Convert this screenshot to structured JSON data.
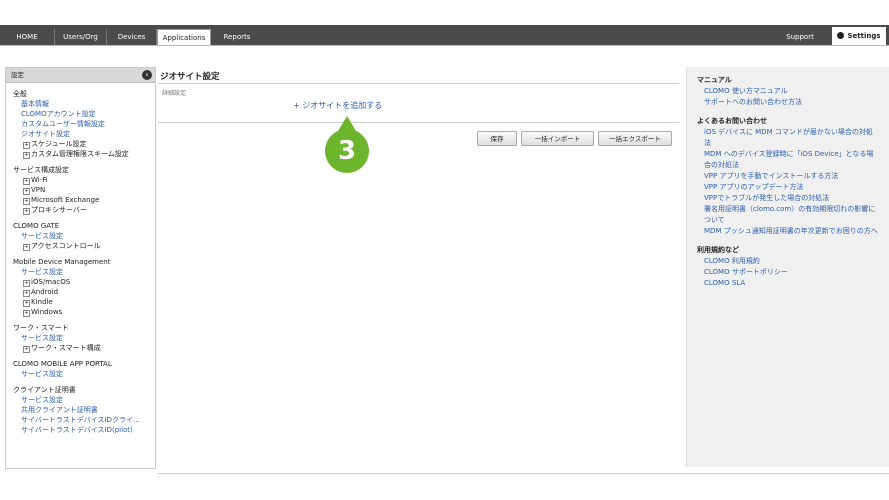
{
  "nav": {
    "tabs": [
      "HOME",
      "Users/Org",
      "Devices",
      "Applications",
      "Reports"
    ],
    "support": "Support",
    "settings": "Settings"
  },
  "sidebar": {
    "header": "設定",
    "groups": [
      {
        "title": "全般",
        "items": [
          {
            "type": "link",
            "label": "基本情報"
          },
          {
            "type": "link",
            "label": "CLOMOアカウント設定"
          },
          {
            "type": "link",
            "label": "カスタムユーザー情報設定"
          },
          {
            "type": "link",
            "label": "ジオサイト設定"
          },
          {
            "type": "sub",
            "label": "スケジュール設定"
          },
          {
            "type": "sub",
            "label": "カスタム管理権限スキーム設定"
          }
        ]
      },
      {
        "title": "サービス構成設定",
        "items": [
          {
            "type": "sub",
            "label": "Wi-Fi"
          },
          {
            "type": "sub",
            "label": "VPN"
          },
          {
            "type": "sub",
            "label": "Microsoft Exchange"
          },
          {
            "type": "sub",
            "label": "プロキシサーバー"
          }
        ]
      },
      {
        "title": "CLOMO GATE",
        "items": [
          {
            "type": "link",
            "label": "サービス設定"
          },
          {
            "type": "sub",
            "label": "アクセスコントロール"
          }
        ]
      },
      {
        "title": "Mobile Device Management",
        "items": [
          {
            "type": "link",
            "label": "サービス設定"
          },
          {
            "type": "sub",
            "label": "iOS/macOS"
          },
          {
            "type": "sub",
            "label": "Android"
          },
          {
            "type": "sub",
            "label": "Kindle"
          },
          {
            "type": "sub",
            "label": "Windows"
          }
        ]
      },
      {
        "title": "ワーク・スマート",
        "items": [
          {
            "type": "link",
            "label": "サービス設定"
          },
          {
            "type": "sub",
            "label": "ワーク・スマート構成"
          }
        ]
      },
      {
        "title": "CLOMO MOBILE APP PORTAL",
        "items": [
          {
            "type": "link",
            "label": "サービス設定"
          }
        ]
      },
      {
        "title": "クライアント証明書",
        "items": [
          {
            "type": "link",
            "label": "サービス設定"
          },
          {
            "type": "link",
            "label": "共用クライアント証明書"
          },
          {
            "type": "link",
            "label": "サイバートラストデバイスIDクライ..."
          },
          {
            "type": "link",
            "label": "サイバートラストデバイスID(pilot)"
          }
        ]
      }
    ]
  },
  "main": {
    "title": "ジオサイト設定",
    "detail_label": "詳細設定",
    "add_link": "+ ジオサイトを追加する",
    "buttons": {
      "save": "保存",
      "import": "一括インポート",
      "export": "一括エクスポート"
    },
    "callout": "3"
  },
  "help": {
    "manual_title": "マニュアル",
    "manual_links": [
      "CLOMO 使い方マニュアル",
      "サポートへのお問い合わせ方法"
    ],
    "faq_title": "よくあるお問い合わせ",
    "faq_links": [
      "iOS デバイスに MDM コマンドが届かない場合の対処法",
      "MDM へのデバイス登録時に「iOS Device」となる場合の対処法",
      "VPP アプリを手動でインストールする方法",
      "VPP アプリのアップデート方法",
      "VPPでトラブルが発生した場合の対処法",
      "署名用証明書（clomo.com）の有効期限切れの影響について",
      "MDM プッシュ通知用証明書の年次更新でお困りの方へ"
    ],
    "terms_title": "利用規約など",
    "terms_links": [
      "CLOMO 利用規約",
      "CLOMO サポートポリシー",
      "CLOMO SLA"
    ]
  },
  "colors": {
    "nav_bg": "#4b4b4b",
    "link": "#2a5db0",
    "callout": "#6cb52d"
  }
}
